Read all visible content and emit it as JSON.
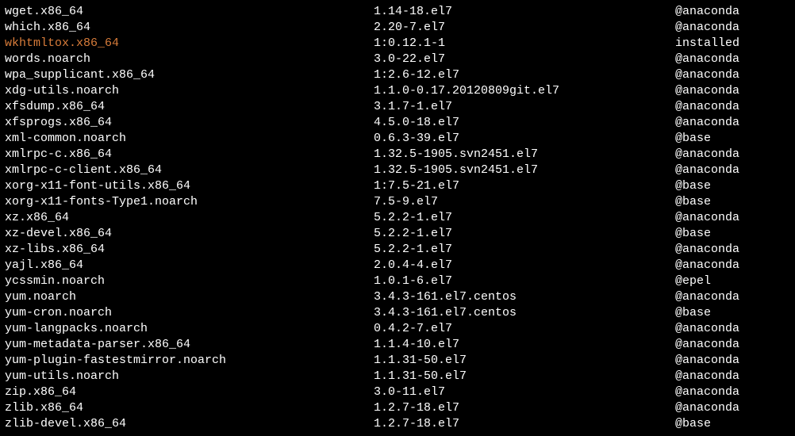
{
  "packages": [
    {
      "name": "wget.x86_64",
      "version": "1.14-18.el7",
      "repo": "@anaconda",
      "highlight": false
    },
    {
      "name": "which.x86_64",
      "version": "2.20-7.el7",
      "repo": "@anaconda",
      "highlight": false
    },
    {
      "name": "wkhtmltox.x86_64",
      "version": "1:0.12.1-1",
      "repo": "installed",
      "highlight": true
    },
    {
      "name": "words.noarch",
      "version": "3.0-22.el7",
      "repo": "@anaconda",
      "highlight": false
    },
    {
      "name": "wpa_supplicant.x86_64",
      "version": "1:2.6-12.el7",
      "repo": "@anaconda",
      "highlight": false
    },
    {
      "name": "xdg-utils.noarch",
      "version": "1.1.0-0.17.20120809git.el7",
      "repo": "@anaconda",
      "highlight": false
    },
    {
      "name": "xfsdump.x86_64",
      "version": "3.1.7-1.el7",
      "repo": "@anaconda",
      "highlight": false
    },
    {
      "name": "xfsprogs.x86_64",
      "version": "4.5.0-18.el7",
      "repo": "@anaconda",
      "highlight": false
    },
    {
      "name": "xml-common.noarch",
      "version": "0.6.3-39.el7",
      "repo": "@base",
      "highlight": false
    },
    {
      "name": "xmlrpc-c.x86_64",
      "version": "1.32.5-1905.svn2451.el7",
      "repo": "@anaconda",
      "highlight": false
    },
    {
      "name": "xmlrpc-c-client.x86_64",
      "version": "1.32.5-1905.svn2451.el7",
      "repo": "@anaconda",
      "highlight": false
    },
    {
      "name": "xorg-x11-font-utils.x86_64",
      "version": "1:7.5-21.el7",
      "repo": "@base",
      "highlight": false
    },
    {
      "name": "xorg-x11-fonts-Type1.noarch",
      "version": "7.5-9.el7",
      "repo": "@base",
      "highlight": false
    },
    {
      "name": "xz.x86_64",
      "version": "5.2.2-1.el7",
      "repo": "@anaconda",
      "highlight": false
    },
    {
      "name": "xz-devel.x86_64",
      "version": "5.2.2-1.el7",
      "repo": "@base",
      "highlight": false
    },
    {
      "name": "xz-libs.x86_64",
      "version": "5.2.2-1.el7",
      "repo": "@anaconda",
      "highlight": false
    },
    {
      "name": "yajl.x86_64",
      "version": "2.0.4-4.el7",
      "repo": "@anaconda",
      "highlight": false
    },
    {
      "name": "ycssmin.noarch",
      "version": "1.0.1-6.el7",
      "repo": "@epel",
      "highlight": false
    },
    {
      "name": "yum.noarch",
      "version": "3.4.3-161.el7.centos",
      "repo": "@anaconda",
      "highlight": false
    },
    {
      "name": "yum-cron.noarch",
      "version": "3.4.3-161.el7.centos",
      "repo": "@base",
      "highlight": false
    },
    {
      "name": "yum-langpacks.noarch",
      "version": "0.4.2-7.el7",
      "repo": "@anaconda",
      "highlight": false
    },
    {
      "name": "yum-metadata-parser.x86_64",
      "version": "1.1.4-10.el7",
      "repo": "@anaconda",
      "highlight": false
    },
    {
      "name": "yum-plugin-fastestmirror.noarch",
      "version": "1.1.31-50.el7",
      "repo": "@anaconda",
      "highlight": false
    },
    {
      "name": "yum-utils.noarch",
      "version": "1.1.31-50.el7",
      "repo": "@anaconda",
      "highlight": false
    },
    {
      "name": "zip.x86_64",
      "version": "3.0-11.el7",
      "repo": "@anaconda",
      "highlight": false
    },
    {
      "name": "zlib.x86_64",
      "version": "1.2.7-18.el7",
      "repo": "@anaconda",
      "highlight": false
    },
    {
      "name": "zlib-devel.x86_64",
      "version": "1.2.7-18.el7",
      "repo": "@base",
      "highlight": false
    }
  ]
}
